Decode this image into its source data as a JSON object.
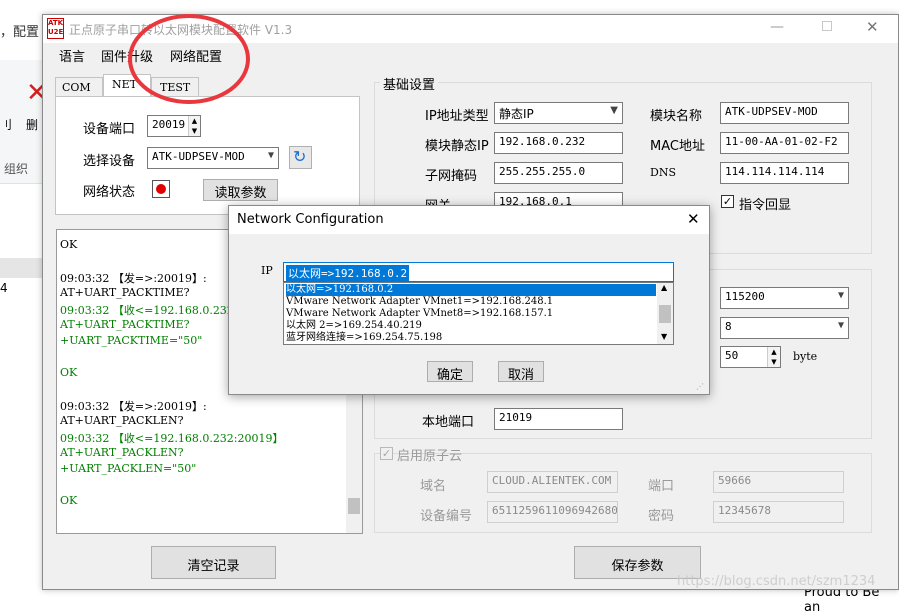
{
  "background": {
    "left_text": "，配置",
    "delete_label": "删",
    "ribbon_left": "刂",
    "group_label": "组织",
    "row_number": "4",
    "right_text": "Proud to Be an",
    "watermark": "https://blog.csdn.net/szm1234"
  },
  "app": {
    "logo_top": "ATK",
    "logo_bottom": "U2E",
    "title": "正点原子串口转以太网模块配置软件 V1.3",
    "menu": [
      "语言",
      "固件升级",
      "网络配置"
    ],
    "tabs": [
      "COM",
      "NET",
      "TEST"
    ],
    "active_tab": "NET",
    "net": {
      "port_label": "设备端口",
      "port_value": "20019",
      "device_label": "选择设备",
      "device_value": "ATK-UDPSEV-MOD",
      "status_label": "网络状态",
      "read_button": "读取参数"
    },
    "log": [
      {
        "text": "OK",
        "color": "black"
      },
      {
        "text": "",
        "color": "black"
      },
      {
        "text": "09:03:32 【发=>:20019】:",
        "color": "black"
      },
      {
        "text": "AT+UART_PACKTIME?",
        "color": "black"
      },
      {
        "text": "09:03:32 【收<=192.168.0.232:",
        "color": "green"
      },
      {
        "text": "AT+UART_PACKTIME?",
        "color": "green"
      },
      {
        "text": "+UART_PACKTIME=\"50\"",
        "color": "green"
      },
      {
        "text": "",
        "color": "black"
      },
      {
        "text": "OK",
        "color": "green"
      },
      {
        "text": "",
        "color": "black"
      },
      {
        "text": "09:03:32 【发=>:20019】:",
        "color": "black"
      },
      {
        "text": "AT+UART_PACKLEN?",
        "color": "black"
      },
      {
        "text": "09:03:32 【收<=192.168.0.232:20019】",
        "color": "green"
      },
      {
        "text": "AT+UART_PACKLEN?",
        "color": "green"
      },
      {
        "text": "+UART_PACKLEN=\"50\"",
        "color": "green"
      },
      {
        "text": "",
        "color": "black"
      },
      {
        "text": "OK",
        "color": "green"
      }
    ],
    "clear_button": "清空记录",
    "basic": {
      "title": "基础设置",
      "ip_type_label": "IP地址类型",
      "ip_type_value": "静态IP",
      "static_ip_label": "模块静态IP",
      "static_ip_value": "192.168.0.232",
      "subnet_label": "子网掩码",
      "subnet_value": "255.255.255.0",
      "gateway_label": "网关",
      "gateway_value": "192.168.0.1",
      "module_name_label": "模块名称",
      "module_name_value": "ATK-UDPSEV-MOD",
      "mac_label": "MAC地址",
      "mac_value": "11-00-AA-01-02-F2",
      "dns_label": "DNS",
      "dns_value": "114.114.114.114",
      "echo_label": "指令回显"
    },
    "serial": {
      "baud_value": "115200",
      "databits_value": "8",
      "packlen_value": "50",
      "packlen_unit": "byte",
      "local_port_label": "本地端口",
      "local_port_value": "21019"
    },
    "cloud": {
      "title": "启用原子云",
      "domain_label": "域名",
      "domain_value": "CLOUD.ALIENTEK.COM",
      "port_label": "端口",
      "port_value": "59666",
      "device_id_label": "设备编号",
      "device_id_value": "65112596110969426801",
      "password_label": "密码",
      "password_value": "12345678"
    },
    "save_button": "保存参数"
  },
  "dialog": {
    "title": "Network Configuration",
    "ip_label": "IP",
    "selected": "以太网=>192.168.0.2",
    "options": [
      "以太网=>192.168.0.2",
      "VMware Network Adapter VMnet1=>192.168.248.1",
      "VMware Network Adapter VMnet8=>192.168.157.1",
      "以太网 2=>169.254.40.219",
      "蓝牙网络连接=>169.254.75.198"
    ],
    "ok_button": "确定",
    "cancel_button": "取消"
  }
}
